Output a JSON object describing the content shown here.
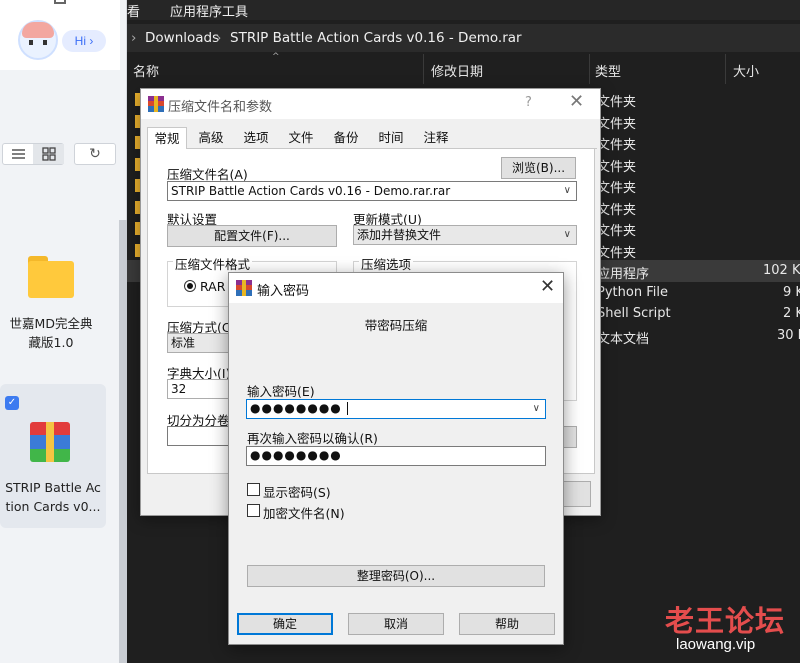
{
  "left_panel": {
    "greeting": "Hi",
    "chevron": "›",
    "refresh_glyph": "↻",
    "folder_label_line1": "世嘉MD完全典",
    "folder_label_line2": "藏版1.0",
    "file_label_line1": "STRIP Battle Ac",
    "file_label_line2": "tion Cards v0...",
    "check_glyph": "✓",
    "icons": [
      "list-view-icon",
      "grid-view-icon",
      "refresh-icon",
      "folder-icon",
      "winrar-archive-icon"
    ]
  },
  "explorer": {
    "menu": [
      "看",
      "应用程序工具"
    ],
    "breadcrumb": [
      "Downloads",
      "STRIP Battle Action Cards v0.16 - Demo.rar"
    ],
    "breadcrumb_sep": "›",
    "columns": [
      "名称",
      "修改日期",
      "类型",
      "大小"
    ],
    "rows": [
      {
        "type": "文件夹",
        "size": ""
      },
      {
        "type": "文件夹",
        "size": ""
      },
      {
        "type": "文件夹",
        "size": ""
      },
      {
        "type": "文件夹",
        "size": ""
      },
      {
        "type": "文件夹",
        "size": ""
      },
      {
        "type": "文件夹",
        "size": ""
      },
      {
        "type": "文件夹",
        "size": ""
      },
      {
        "type": "文件夹",
        "size": ""
      },
      {
        "type": "应用程序",
        "size": "102 K"
      },
      {
        "type": "Python File",
        "size": "9 K"
      },
      {
        "type": "Shell Script",
        "size": "2 K"
      },
      {
        "type": "文本文档",
        "size": "30 K"
      }
    ]
  },
  "archive_dialog": {
    "title": "压缩文件名和参数",
    "help": "?",
    "close": "✕",
    "tabs": [
      "常规",
      "高级",
      "选项",
      "文件",
      "备份",
      "时间",
      "注释"
    ],
    "archive_name_label": "压缩文件名(A)",
    "browse_button": "浏览(B)...",
    "archive_name_value": "STRIP Battle Action Cards v0.16 - Demo.rar.rar",
    "default_settings_label": "默认设置",
    "profiles_button": "配置文件(F)...",
    "update_mode_label": "更新模式(U)",
    "update_mode_value": "添加并替换文件",
    "format_group": "压缩文件格式",
    "format_rar": "RAR",
    "options_group": "压缩选项",
    "method_label": "压缩方式(C)",
    "method_value": "标准",
    "dict_label": "字典大小(I)",
    "dict_value": "32",
    "split_label": "切分为分卷(V"
  },
  "password_dialog": {
    "title": "输入密码",
    "close": "✕",
    "subtitle": "带密码压缩",
    "enter_label": "输入密码(E)",
    "enter_value": "●●●●●●●●",
    "confirm_label": "再次输入密码以确认(R)",
    "confirm_value": "●●●●●●●●",
    "show_password": "显示密码(S)",
    "encrypt_names": "加密文件名(N)",
    "organize_button": "整理密码(O)...",
    "ok": "确定",
    "cancel": "取消",
    "help": "帮助"
  },
  "watermark": {
    "line1": "老王论坛",
    "line2": "laowang.vip"
  },
  "colors": {
    "accent": "#0078d7",
    "explorer_bg": "#1f1f1f",
    "watermark_red": "#e44d4d"
  }
}
